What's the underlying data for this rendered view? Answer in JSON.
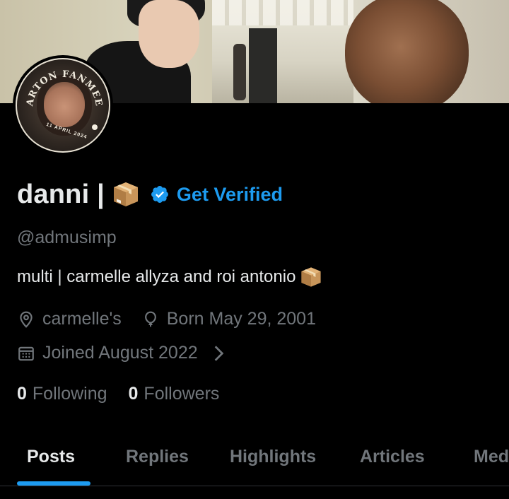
{
  "banner": {
    "description_icon": "banner-photo"
  },
  "avatar": {
    "ring_text": "CARTON FANMEET",
    "date_text": "11 APRIL 2024"
  },
  "profile": {
    "display_name": "danni |",
    "get_verified_label": "Get Verified",
    "handle": "@admusimp",
    "bio": "multi | carmelle allyza and roi antonio",
    "location": "carmelle's",
    "birthday": "Born May 29, 2001",
    "joined": "Joined August 2022",
    "following_count": "0",
    "following_label": "Following",
    "followers_count": "0",
    "followers_label": "Followers"
  },
  "tabs": [
    {
      "label": "Posts",
      "active": true
    },
    {
      "label": "Replies",
      "active": false
    },
    {
      "label": "Highlights",
      "active": false
    },
    {
      "label": "Articles",
      "active": false
    },
    {
      "label": "Media",
      "active": false
    }
  ],
  "colors": {
    "accent": "#1d9bf0",
    "text_primary": "#e7e9ea",
    "text_secondary": "#71767b",
    "background": "#000000"
  },
  "icons": {
    "verified": "verified-badge-icon",
    "location": "location-pin-icon",
    "birthday": "balloon-icon",
    "joined": "calendar-icon",
    "chevron": "chevron-right-icon",
    "emoji": "package-emoji-icon"
  }
}
